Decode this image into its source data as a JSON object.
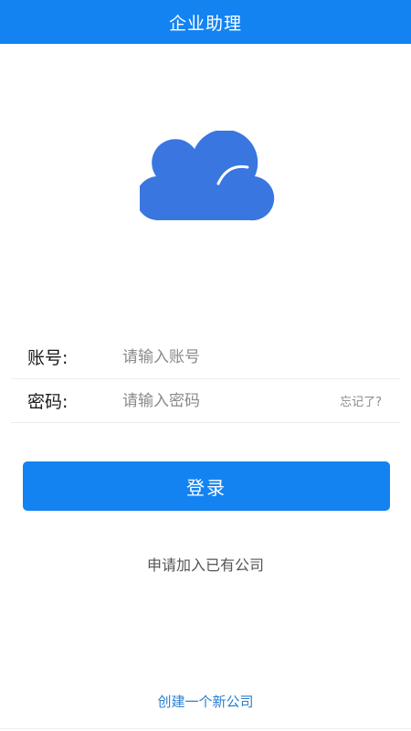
{
  "app": {
    "title": "企业助理"
  },
  "logo": {
    "icon": "cloud-icon",
    "color": "#3a76e0"
  },
  "form": {
    "account": {
      "label": "账号:",
      "placeholder": "请输入账号",
      "value": ""
    },
    "password": {
      "label": "密码:",
      "placeholder": "请输入密码",
      "value": "",
      "forgot_label": "忘记了?"
    }
  },
  "actions": {
    "login_label": "登录",
    "join_label": "申请加入已有公司",
    "create_label": "创建一个新公司"
  },
  "colors": {
    "primary": "#1383f2",
    "link": "#2b7fce"
  }
}
